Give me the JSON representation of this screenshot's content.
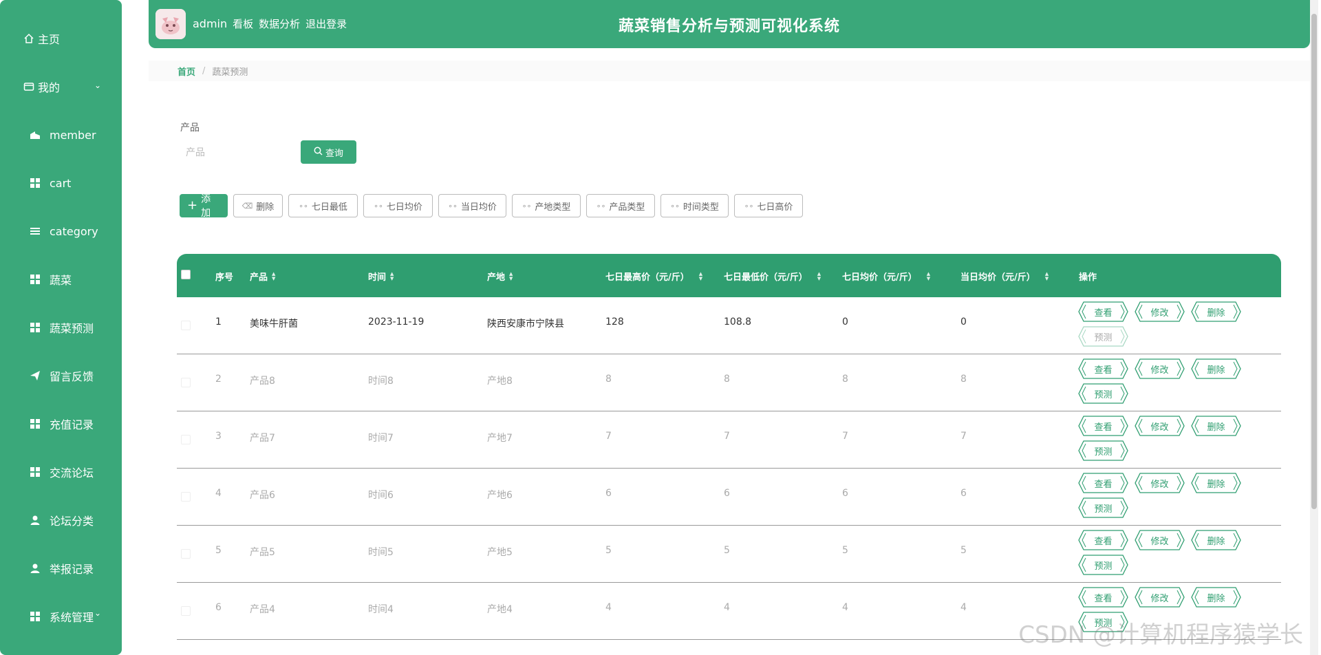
{
  "sidebar": {
    "home": "主页",
    "mine": "我的",
    "items": [
      {
        "label": "member",
        "icon": "building-icon"
      },
      {
        "label": "cart",
        "icon": "grid-icon"
      },
      {
        "label": "category",
        "icon": "list-icon"
      },
      {
        "label": "蔬菜",
        "icon": "grid-icon"
      },
      {
        "label": "蔬菜预测",
        "icon": "grid-icon"
      },
      {
        "label": "留言反馈",
        "icon": "send-icon"
      },
      {
        "label": "充值记录",
        "icon": "grid-icon"
      },
      {
        "label": "交流论坛",
        "icon": "grid-icon"
      },
      {
        "label": "论坛分类",
        "icon": "user-icon"
      },
      {
        "label": "举报记录",
        "icon": "user-icon"
      },
      {
        "label": "系统管理",
        "icon": "grid-icon"
      }
    ]
  },
  "header": {
    "user": "admin",
    "links": [
      "看板",
      "数据分析",
      "退出登录"
    ],
    "title": "蔬菜销售分析与预测可视化系统"
  },
  "breadcrumb": {
    "home": "首页",
    "sep": "/",
    "current": "蔬菜预测"
  },
  "search": {
    "label": "产品",
    "placeholder": "产品",
    "button": "查询"
  },
  "toolbar": {
    "add": "添加",
    "delete": "删除",
    "buttons": [
      "七日最低",
      "七日均价",
      "当日均价",
      "产地类型",
      "产品类型",
      "时间类型",
      "七日高价"
    ]
  },
  "table": {
    "headers": [
      "序号",
      "产品",
      "时间",
      "产地",
      "七日最高价（元/斤）",
      "七日最低价（元/斤）",
      "七日均价（元/斤）",
      "当日均价（元/斤）",
      "操作"
    ],
    "rows": [
      {
        "no": "1",
        "product": "美味牛肝菌",
        "time": "2023-11-19",
        "origin": "陕西安康市宁陕县",
        "max7": "128",
        "min7": "108.8",
        "avg7": "0",
        "avgToday": "0"
      },
      {
        "no": "2",
        "product": "产品8",
        "time": "时间8",
        "origin": "产地8",
        "max7": "8",
        "min7": "8",
        "avg7": "8",
        "avgToday": "8"
      },
      {
        "no": "3",
        "product": "产品7",
        "time": "时间7",
        "origin": "产地7",
        "max7": "7",
        "min7": "7",
        "avg7": "7",
        "avgToday": "7"
      },
      {
        "no": "4",
        "product": "产品6",
        "time": "时间6",
        "origin": "产地6",
        "max7": "6",
        "min7": "6",
        "avg7": "6",
        "avgToday": "6"
      },
      {
        "no": "5",
        "product": "产品5",
        "time": "时间5",
        "origin": "产地5",
        "max7": "5",
        "min7": "5",
        "avg7": "5",
        "avgToday": "5"
      },
      {
        "no": "6",
        "product": "产品4",
        "time": "时间4",
        "origin": "产地4",
        "max7": "4",
        "min7": "4",
        "avg7": "4",
        "avgToday": "4"
      }
    ],
    "actions": {
      "view": "查看",
      "edit": "修改",
      "delete": "删除",
      "predict": "预测"
    }
  },
  "watermark": "CSDN @计算机程序猿学长",
  "colors": {
    "primary": "#3aa87a",
    "header": "#2f9e70"
  }
}
